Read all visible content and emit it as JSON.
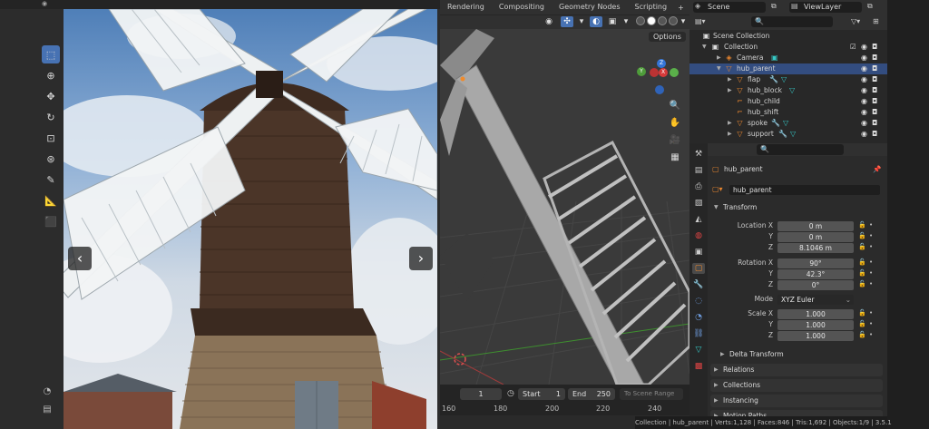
{
  "workspace_tabs": [
    "Rendering",
    "Compositing",
    "Geometry Nodes",
    "Scripting"
  ],
  "workspace_add": "+",
  "scene_selector": {
    "label": "Scene"
  },
  "view_layer": {
    "label": "ViewLayer"
  },
  "viewport": {
    "options_label": "Options"
  },
  "photo": {
    "prev_glyph": "‹",
    "next_glyph": "›"
  },
  "gizmo": {
    "z": "Z",
    "y": "Y",
    "x": "X"
  },
  "timeline": {
    "current_frame": "1",
    "start_label": "Start",
    "start_value": "1",
    "end_label": "End",
    "end_value": "250",
    "scene_range_label": "To Scene Range",
    "ruler": [
      "160",
      "180",
      "200",
      "220",
      "240"
    ]
  },
  "outliner": {
    "rows": [
      {
        "label": "Scene Collection",
        "icon": "scene-collection-icon"
      },
      {
        "label": "Collection",
        "icon": "collection-icon"
      },
      {
        "label": "Camera",
        "icon": "camera-object-icon"
      },
      {
        "label": "hub_parent",
        "icon": "mesh-object-icon",
        "selected": true
      },
      {
        "label": "flap",
        "icon": "mesh-object-icon"
      },
      {
        "label": "hub_block",
        "icon": "mesh-object-icon"
      },
      {
        "label": "hub_child",
        "icon": "empty-object-icon"
      },
      {
        "label": "hub_shift",
        "icon": "empty-object-icon"
      },
      {
        "label": "spoke",
        "icon": "mesh-object-icon"
      },
      {
        "label": "support",
        "icon": "mesh-object-icon"
      }
    ]
  },
  "properties": {
    "object_name_header": "hub_parent",
    "object_name_field": "hub_parent",
    "transform_label": "Transform",
    "location": {
      "x_label": "Location X",
      "y_label": "Y",
      "z_label": "Z",
      "x": "0 m",
      "y": "0 m",
      "z": "8.1046 m"
    },
    "rotation": {
      "x_label": "Rotation X",
      "y_label": "Y",
      "z_label": "Z",
      "x": "90°",
      "y": "42.3°",
      "z": "0°"
    },
    "mode_label": "Mode",
    "mode_value": "XYZ Euler",
    "scale": {
      "x_label": "Scale X",
      "y_label": "Y",
      "z_label": "Z",
      "x": "1.000",
      "y": "1.000",
      "z": "1.000"
    },
    "delta_transform": "Delta Transform",
    "panels": [
      "Relations",
      "Collections",
      "Instancing",
      "Motion Paths"
    ]
  },
  "status_bar": "Collection | hub_parent | Verts:1,128 | Faces:846 | Tris:1,692 | Objects:1/9 | 3.5.1",
  "colors": {
    "accent": "#4772b3",
    "selected_row": "#334d80",
    "mesh_orange": "#e8862f",
    "modifier_cyan": "#36c9c6",
    "wrench_blue": "#6f9ee0"
  }
}
